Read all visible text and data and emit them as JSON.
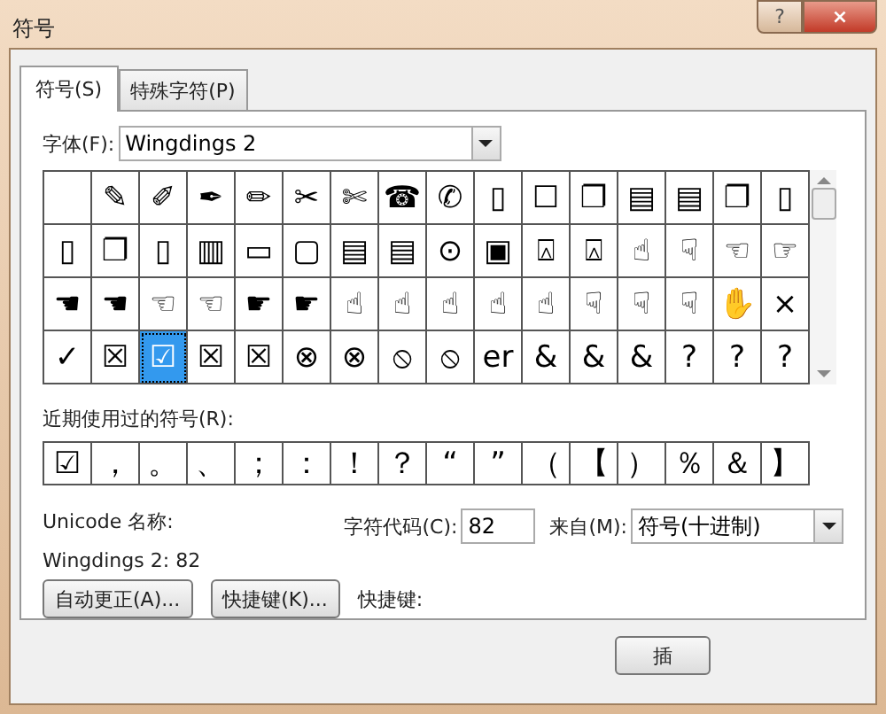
{
  "window": {
    "title": "符号",
    "buttons": [
      {
        "kind": "help",
        "label": "?"
      },
      {
        "kind": "close",
        "label": "×"
      }
    ]
  },
  "tabs": [
    {
      "label": "符号(S)",
      "selected": true
    },
    {
      "label": "特殊字符(P)",
      "selected": false
    }
  ],
  "font": {
    "label": "字体(F):",
    "value": "Wingdings 2"
  },
  "symbols": [
    [
      {
        "selected": false
      },
      {
        "symbol": "✎",
        "selected": false
      },
      {
        "symbol": "✐",
        "selected": false
      },
      {
        "symbol": "✒",
        "selected": false
      },
      {
        "symbol": "✏",
        "selected": false
      },
      {
        "symbol": "✂",
        "selected": false
      },
      {
        "symbol": "✄",
        "selected": false
      },
      {
        "symbol": "☎",
        "selected": false
      },
      {
        "symbol": "✆",
        "selected": false
      },
      {
        "symbol": "▯",
        "selected": false
      },
      {
        "symbol": "☐",
        "selected": false
      },
      {
        "symbol": "❐",
        "selected": false
      },
      {
        "symbol": "▤",
        "selected": false
      },
      {
        "symbol": "▤",
        "selected": false
      },
      {
        "symbol": "❐",
        "selected": false
      },
      {
        "symbol": "▯",
        "selected": false
      }
    ],
    [
      {
        "symbol": "▯",
        "selected": false
      },
      {
        "symbol": "❐",
        "selected": false
      },
      {
        "symbol": "▯",
        "selected": false
      },
      {
        "symbol": "▥",
        "selected": false
      },
      {
        "symbol": "▭",
        "selected": false
      },
      {
        "symbol": "▢",
        "selected": false
      },
      {
        "symbol": "▤",
        "selected": false
      },
      {
        "symbol": "▤",
        "selected": false
      },
      {
        "symbol": "⊙",
        "selected": false
      },
      {
        "symbol": "▣",
        "selected": false
      },
      {
        "symbol": "⍓",
        "selected": false
      },
      {
        "symbol": "⍓",
        "selected": false
      },
      {
        "symbol": "☝",
        "selected": false
      },
      {
        "symbol": "☟",
        "selected": false
      },
      {
        "symbol": "☜",
        "selected": false
      },
      {
        "symbol": "☞",
        "selected": false
      }
    ],
    [
      {
        "symbol": "☚",
        "selected": false
      },
      {
        "symbol": "☚",
        "selected": false
      },
      {
        "symbol": "☜",
        "selected": false
      },
      {
        "symbol": "☜",
        "selected": false
      },
      {
        "symbol": "☛",
        "selected": false
      },
      {
        "symbol": "☛",
        "selected": false
      },
      {
        "symbol": "☝",
        "selected": false
      },
      {
        "symbol": "☝",
        "selected": false
      },
      {
        "symbol": "☝",
        "selected": false
      },
      {
        "symbol": "☝",
        "selected": false
      },
      {
        "symbol": "☝",
        "selected": false
      },
      {
        "symbol": "☟",
        "selected": false
      },
      {
        "symbol": "☟",
        "selected": false
      },
      {
        "symbol": "☟",
        "selected": false
      },
      {
        "symbol": "✋",
        "selected": false
      },
      {
        "symbol": "×",
        "selected": false
      }
    ],
    [
      {
        "symbol": "✓",
        "selected": false
      },
      {
        "symbol": "☒",
        "selected": false
      },
      {
        "symbol": "☑",
        "selected": true
      },
      {
        "symbol": "☒",
        "selected": false
      },
      {
        "symbol": "☒",
        "selected": false
      },
      {
        "symbol": "⊗",
        "selected": false
      },
      {
        "symbol": "⊗",
        "selected": false
      },
      {
        "symbol": "⦸",
        "selected": false
      },
      {
        "symbol": "⦸",
        "selected": false
      },
      {
        "symbol": "er",
        "selected": false
      },
      {
        "symbol": "&",
        "selected": false
      },
      {
        "symbol": "&",
        "selected": false
      },
      {
        "symbol": "&",
        "selected": false
      },
      {
        "symbol": "?",
        "selected": false
      },
      {
        "symbol": "?",
        "selected": false
      },
      {
        "symbol": "?",
        "selected": false
      }
    ]
  ],
  "recent": {
    "label": "近期使用过的符号(R):",
    "symbols": [
      "☑",
      "，",
      "。",
      "、",
      "；",
      "：",
      "！",
      "？",
      "“",
      "”",
      "（",
      "【",
      "）",
      "％",
      "＆",
      "】"
    ]
  },
  "unicode_name": {
    "label": "Unicode 名称:",
    "value": "Wingdings 2: 82"
  },
  "char_code": {
    "label": "字符代码(C):",
    "value": "82"
  },
  "from": {
    "label": "来自(M):",
    "value": "符号(十进制)"
  },
  "buttons": [
    "自动更正(A)...",
    "快捷键(K)..."
  ],
  "shortcut_label": "快捷键:",
  "insert_button": "插"
}
